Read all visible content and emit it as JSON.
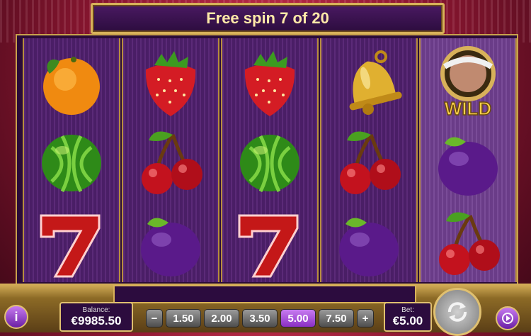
{
  "banner": {
    "text": "Free spin 7 of 20"
  },
  "reels": [
    [
      "orange-icon",
      "watermelon-icon",
      "seven-icon"
    ],
    [
      "strawberry-icon",
      "cherry-icon",
      "plum-icon"
    ],
    [
      "strawberry-icon",
      "watermelon-icon",
      "seven-icon"
    ],
    [
      "bell-icon",
      "cherry-icon",
      "plum-icon"
    ],
    [
      "wild-icon",
      "plum-icon",
      "cherry-icon"
    ]
  ],
  "wild_label": "WILD",
  "balance": {
    "label": "Balance:",
    "value": "€9985.50"
  },
  "bet": {
    "label": "Bet:",
    "value": "€5.00"
  },
  "bet_options": [
    "1.50",
    "2.00",
    "3.50",
    "5.00",
    "7.50"
  ],
  "bet_selected": "5.00",
  "minus_label": "−",
  "plus_label": "+",
  "info_label": "i",
  "colors": {
    "accent_purple": "#8a2fc4",
    "gold": "#d8b15a",
    "banner_text": "#ffe9a8"
  }
}
